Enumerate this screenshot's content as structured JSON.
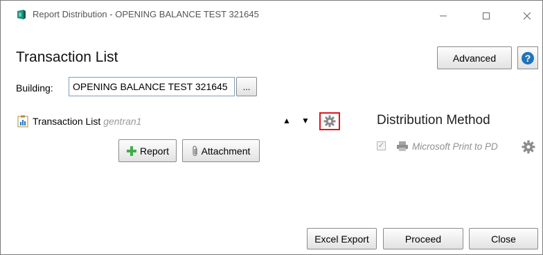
{
  "window": {
    "title": "Report Distribution - OPENING BALANCE TEST 321645",
    "controls": [
      "minimize-icon",
      "maximize-icon",
      "close-icon"
    ]
  },
  "header": {
    "title": "Transaction List",
    "advanced_label": "Advanced",
    "help_icon": "help-icon",
    "help_glyph": "?"
  },
  "building": {
    "label": "Building:",
    "value": "OPENING BALANCE TEST 321645",
    "browse_label": "..."
  },
  "report": {
    "name": "Transaction List",
    "subtitle": "gentran1",
    "icon": "report-chart-icon",
    "move_up_glyph": "▲",
    "move_down_glyph": "▼",
    "settings_icon": "gear-icon",
    "add_report_label": "Report",
    "attachment_label": "Attachment"
  },
  "distribution": {
    "title": "Distribution Method",
    "method_name": "Microsoft Print to PD",
    "checked": true,
    "check_glyph": "✓",
    "icon": "printer-icon"
  },
  "footer": {
    "excel_label": "Excel Export",
    "proceed_label": "Proceed",
    "close_label": "Close"
  },
  "colors": {
    "accent_blue": "#1e73be",
    "highlight_red": "#e0141e",
    "plus_green": "#3fae49"
  }
}
